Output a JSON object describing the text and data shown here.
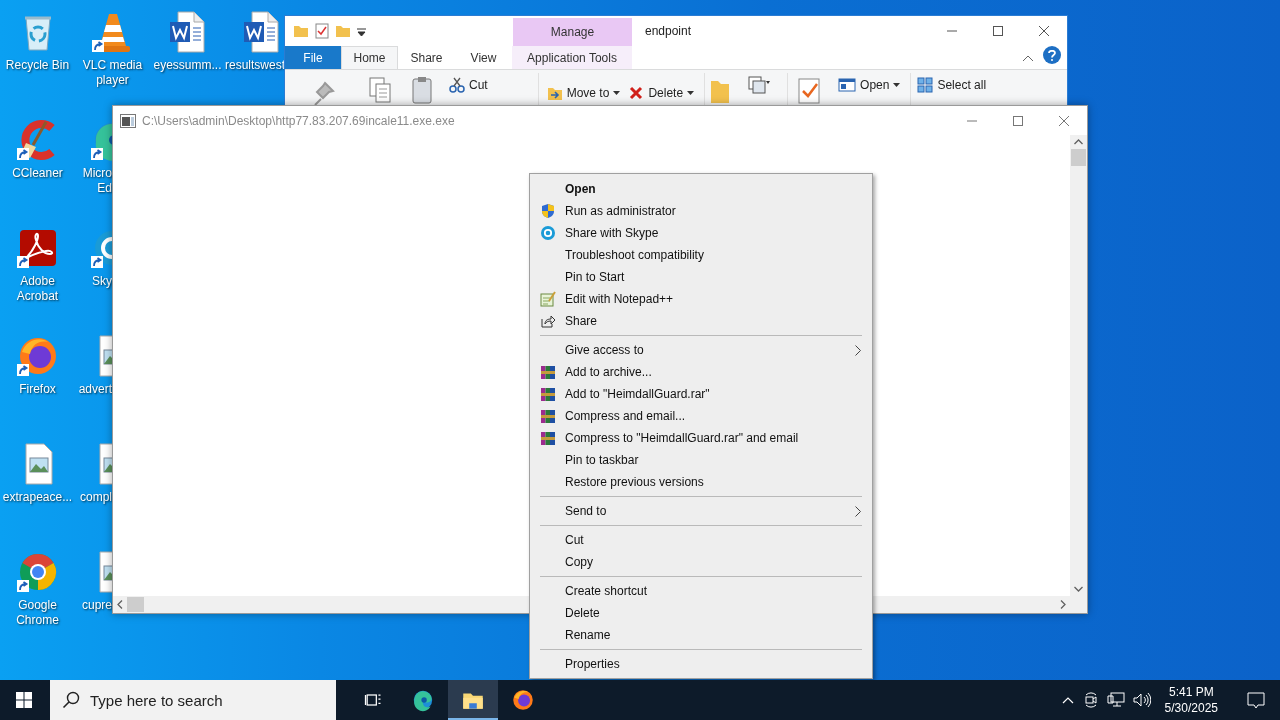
{
  "desktop": {
    "columns": [
      {
        "icons": [
          {
            "label": "Recycle Bin",
            "kind": "recycle",
            "shortcut": false,
            "cut": false
          },
          {
            "label": "CCleaner",
            "kind": "ccleaner",
            "shortcut": true,
            "cut": false
          },
          {
            "label": "Adobe Acrobat",
            "kind": "acrobat",
            "shortcut": true,
            "cut": false
          },
          {
            "label": "Firefox",
            "kind": "firefox",
            "shortcut": true,
            "cut": false
          },
          {
            "label": "extrapeace...",
            "kind": "image",
            "shortcut": false,
            "cut": false
          },
          {
            "label": "Google Chrome",
            "kind": "chrome",
            "shortcut": true,
            "cut": false
          }
        ]
      },
      {
        "icons": [
          {
            "label": "VLC media player",
            "kind": "vlc",
            "shortcut": true,
            "cut": false
          },
          {
            "label": "Micro\nEd",
            "kind": "edge",
            "shortcut": true,
            "cut": true
          },
          {
            "label": "Sky",
            "kind": "skype",
            "shortcut": true,
            "cut": true
          },
          {
            "label": "advert",
            "kind": "image",
            "shortcut": false,
            "cut": true
          },
          {
            "label": "compl",
            "kind": "image",
            "shortcut": false,
            "cut": true
          },
          {
            "label": "cupre",
            "kind": "image",
            "shortcut": false,
            "cut": true
          }
        ]
      },
      {
        "icons": [
          {
            "label": "eyessumm...",
            "kind": "word",
            "shortcut": false,
            "cut": false
          }
        ]
      },
      {
        "icons": [
          {
            "label": "resultswest",
            "kind": "word",
            "shortcut": false,
            "cut": true
          }
        ]
      }
    ]
  },
  "explorer": {
    "title": "endpoint",
    "context_tab": "Manage",
    "tabs": [
      {
        "label": "File",
        "kind": "file",
        "selected": false
      },
      {
        "label": "Home",
        "kind": "tab",
        "selected": true
      },
      {
        "label": "Share",
        "kind": "tab",
        "selected": false
      },
      {
        "label": "View",
        "kind": "tab",
        "selected": false
      },
      {
        "label": "Application Tools",
        "kind": "context",
        "selected": false
      }
    ],
    "ribbon": [
      {
        "label": "Cut",
        "kind": "cut",
        "dropdown": false
      },
      {
        "label": "Move to",
        "kind": "moveto",
        "dropdown": true
      },
      {
        "label": "Delete",
        "kind": "delete",
        "dropdown": true
      },
      {
        "label": "Open",
        "kind": "open",
        "dropdown": true
      },
      {
        "label": "Select all",
        "kind": "selectall",
        "dropdown": false
      }
    ]
  },
  "console": {
    "title": "C:\\Users\\admin\\Desktop\\http77.83.207.69incale11.exe.exe"
  },
  "menu": {
    "items": [
      {
        "kind": "item",
        "label": "Open",
        "default": true,
        "submenu": false
      },
      {
        "kind": "item",
        "label": "Run as administrator",
        "default": false,
        "submenu": false
      },
      {
        "kind": "item",
        "label": "Share with Skype",
        "default": false,
        "submenu": false
      },
      {
        "kind": "item",
        "label": "Troubleshoot compatibility",
        "default": false,
        "submenu": false
      },
      {
        "kind": "item",
        "label": "Pin to Start",
        "default": false,
        "submenu": false
      },
      {
        "kind": "item",
        "label": "Edit with Notepad++",
        "default": false,
        "submenu": false
      },
      {
        "kind": "item",
        "label": "Share",
        "default": false,
        "submenu": false
      },
      {
        "kind": "separator"
      },
      {
        "kind": "item",
        "label": "Give access to",
        "default": false,
        "submenu": true
      },
      {
        "kind": "item",
        "label": "Add to archive...",
        "default": false,
        "submenu": false
      },
      {
        "kind": "item",
        "label": "Add to \"HeimdallGuard.rar\"",
        "default": false,
        "submenu": false
      },
      {
        "kind": "item",
        "label": "Compress and email...",
        "default": false,
        "submenu": false
      },
      {
        "kind": "item",
        "label": "Compress to \"HeimdallGuard.rar\" and email",
        "default": false,
        "submenu": false
      },
      {
        "kind": "item",
        "label": "Pin to taskbar",
        "default": false,
        "submenu": false
      },
      {
        "kind": "item",
        "label": "Restore previous versions",
        "default": false,
        "submenu": false
      },
      {
        "kind": "separator"
      },
      {
        "kind": "item",
        "label": "Send to",
        "default": false,
        "submenu": true
      },
      {
        "kind": "separator"
      },
      {
        "kind": "item",
        "label": "Cut",
        "default": false,
        "submenu": false
      },
      {
        "kind": "item",
        "label": "Copy",
        "default": false,
        "submenu": false
      },
      {
        "kind": "separator"
      },
      {
        "kind": "item",
        "label": "Create shortcut",
        "default": false,
        "submenu": false
      },
      {
        "kind": "item",
        "label": "Delete",
        "default": false,
        "submenu": false
      },
      {
        "kind": "item",
        "label": "Rename",
        "default": false,
        "submenu": false
      },
      {
        "kind": "separator"
      },
      {
        "kind": "item",
        "label": "Properties",
        "default": false,
        "submenu": false
      }
    ]
  },
  "taskbar": {
    "search": {
      "placeholder": "Type here to search"
    },
    "apps": [
      {
        "kind": "taskview",
        "active": false
      },
      {
        "kind": "edge",
        "active": false
      },
      {
        "kind": "explorer",
        "active": true
      },
      {
        "kind": "firefox",
        "active": false
      }
    ],
    "time": "5:41 PM",
    "date": "5/30/2025"
  }
}
